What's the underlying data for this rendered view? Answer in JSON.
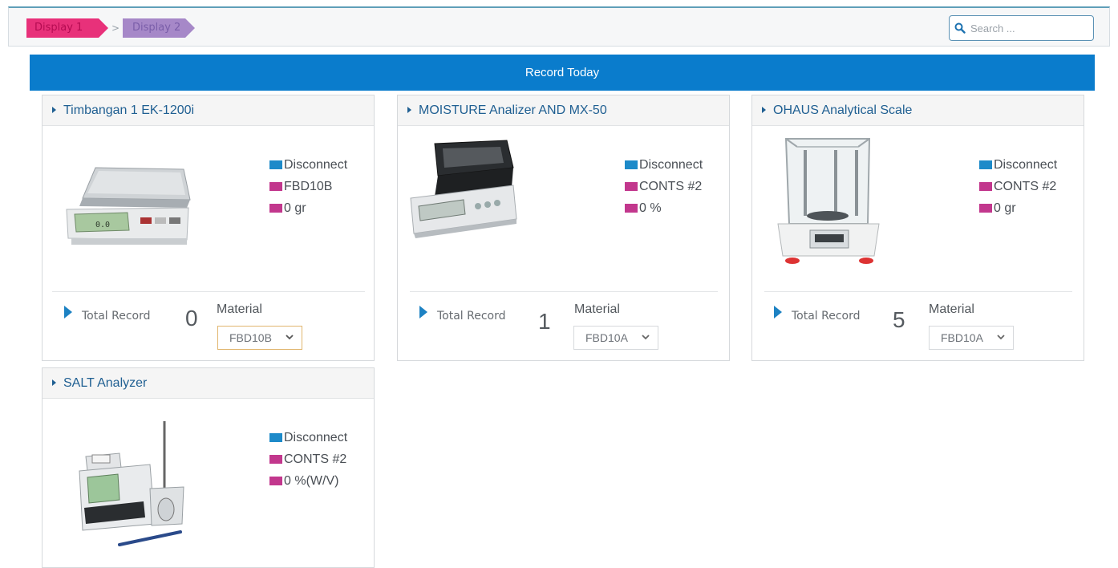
{
  "breadcrumb": {
    "items": [
      "Display 1",
      "Display 2"
    ]
  },
  "search": {
    "placeholder": "Search ..."
  },
  "banner": {
    "title": "Record Today"
  },
  "colors": {
    "banner": "#0a7ccc",
    "status_swatch": "#1d8ac9",
    "info_swatch": "#c2378d",
    "crumb1": "#e8317a",
    "crumb2": "#a688c8"
  },
  "cards": [
    {
      "title": "Timbangan 1 EK-1200i",
      "status": "Disconnect",
      "code": "FBD10B",
      "reading": "0 gr",
      "icon": "scale-icon",
      "total_label": "Total Record",
      "total": "0",
      "material_label": "Material",
      "material": "FBD10B"
    },
    {
      "title": "MOISTURE Analizer AND MX-50",
      "status": "Disconnect",
      "code": "CONTS #2",
      "reading": "0 %",
      "icon": "moisture-analyzer-icon",
      "total_label": "Total Record",
      "total": "1",
      "material_label": "Material",
      "material": "FBD10A"
    },
    {
      "title": "OHAUS Analytical Scale",
      "status": "Disconnect",
      "code": "CONTS #2",
      "reading": "0 gr",
      "icon": "analytical-balance-icon",
      "total_label": "Total Record",
      "total": "5",
      "material_label": "Material",
      "material": "FBD10A"
    },
    {
      "title": "SALT Analyzer",
      "status": "Disconnect",
      "code": "CONTS #2",
      "reading": "0 %(W/V)",
      "icon": "salt-analyzer-icon"
    }
  ]
}
